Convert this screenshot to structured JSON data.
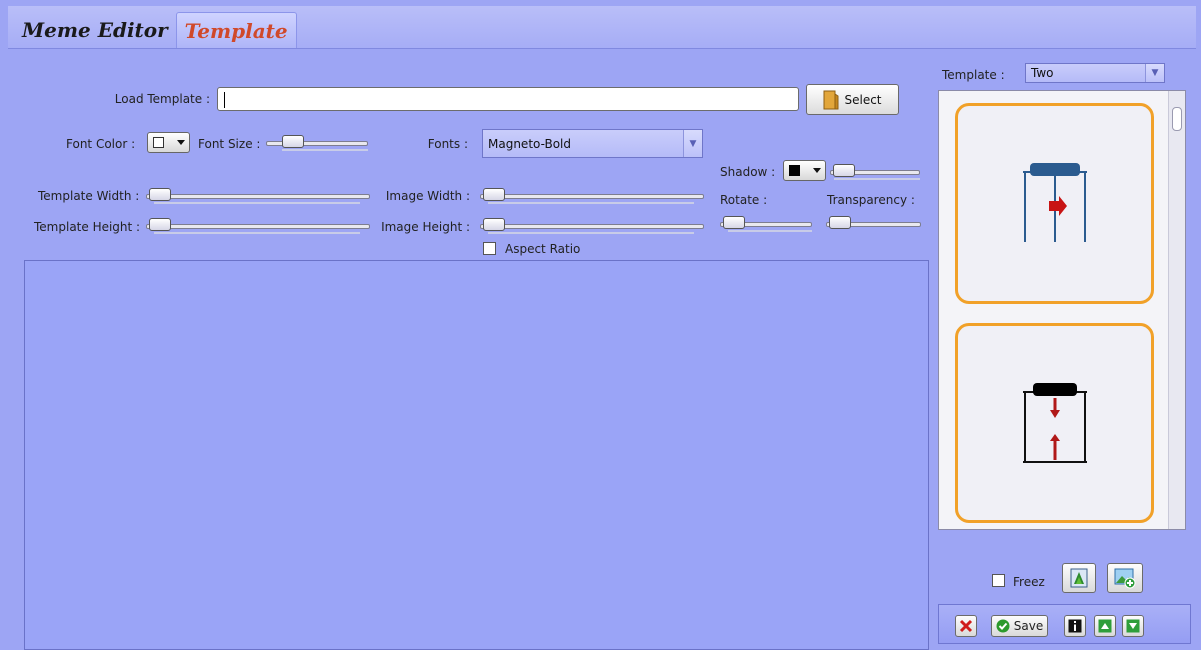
{
  "tabs": [
    {
      "label": "Meme Editor",
      "active": false
    },
    {
      "label": "Template",
      "active": true
    }
  ],
  "load_template": {
    "label": "Load Template :",
    "value": "",
    "select_label": "Select"
  },
  "font_color": {
    "label": "Font Color :",
    "swatch": "#ffffff"
  },
  "font_size": {
    "label": "Font Size :"
  },
  "fonts": {
    "label": "Fonts :",
    "value": "Magneto-Bold"
  },
  "shadow": {
    "label": "Shadow :",
    "swatch": "#000000"
  },
  "template_width": {
    "label": "Template Width :"
  },
  "template_height": {
    "label": "Template Height :"
  },
  "image_width": {
    "label": "Image Width :"
  },
  "image_height": {
    "label": "Image Height :"
  },
  "rotate": {
    "label": "Rotate :"
  },
  "transparency": {
    "label": "Transparency :"
  },
  "aspect_ratio": {
    "label": "Aspect Ratio",
    "checked": false
  },
  "template_select": {
    "label": "Template :",
    "value": "Two"
  },
  "freez": {
    "label": "Freez",
    "checked": false
  },
  "bottom": {
    "save_label": "Save"
  },
  "icons": [
    "folder-icon",
    "template-horizontal-arrow-icon",
    "template-vertical-arrows-icon",
    "scan-icon",
    "add-image-icon",
    "close-icon",
    "check-icon",
    "info-icon",
    "arrow-up-icon",
    "arrow-down-icon"
  ],
  "colors": {
    "background": "#9da5f4",
    "active_tab": "#d0492a",
    "card_border": "#f1a129",
    "template_blue": "#2b5b8f",
    "arrow_red": "#b01818"
  }
}
